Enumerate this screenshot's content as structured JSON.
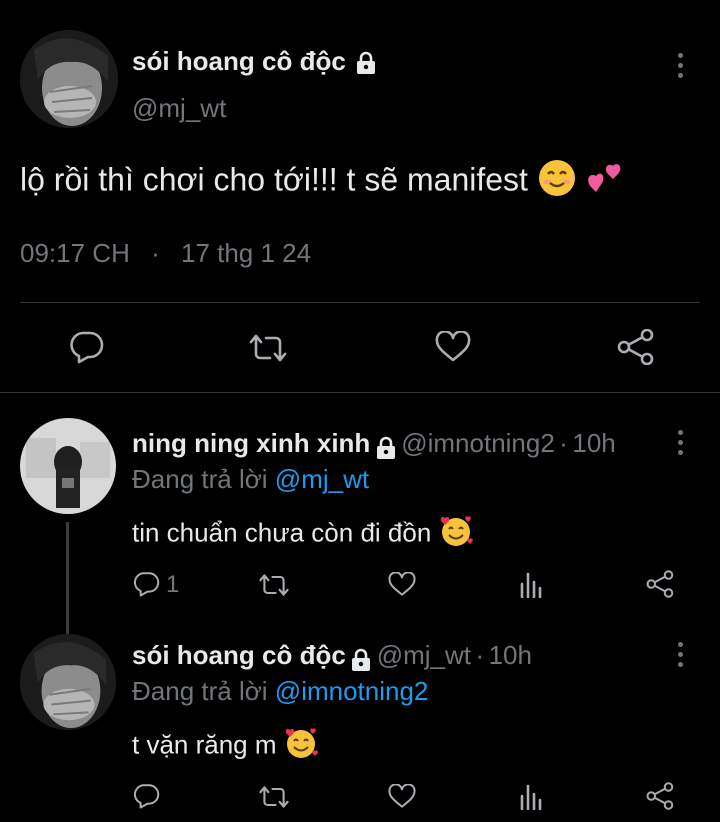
{
  "main_tweet": {
    "display_name": "sói hoang cô độc",
    "handle": "@mj_wt",
    "text": "lộ rồi thì chơi cho tới!!! t sẽ manifest",
    "time": "09:17 CH",
    "separator": "·",
    "date": "17 thg 1 24"
  },
  "replies": [
    {
      "display_name": "ning ning xinh xinh",
      "handle": "@imnotning2",
      "dot": "·",
      "time": "10h",
      "replying_prefix": "Đang trả lời",
      "replying_to": "@mj_wt",
      "text": "tin chuẩn chưa còn đi đồn",
      "reply_count": "1"
    },
    {
      "display_name": "sói hoang cô độc",
      "handle": "@mj_wt",
      "dot": "·",
      "time": "10h",
      "replying_prefix": "Đang trả lời",
      "replying_to": "@imnotning2",
      "text": "t vặn răng m",
      "reply_count": ""
    }
  ],
  "colors": {
    "background": "#000000",
    "text": "#e7e9ea",
    "muted": "#71767b",
    "link": "#1d9bf0",
    "divider": "#2f3336"
  },
  "icons": [
    "lock-icon",
    "more-icon",
    "reply-icon",
    "retweet-icon",
    "like-icon",
    "share-icon",
    "views-icon",
    "smiling-face-emoji",
    "two-hearts-emoji",
    "smiling-face-with-hearts-emoji"
  ]
}
